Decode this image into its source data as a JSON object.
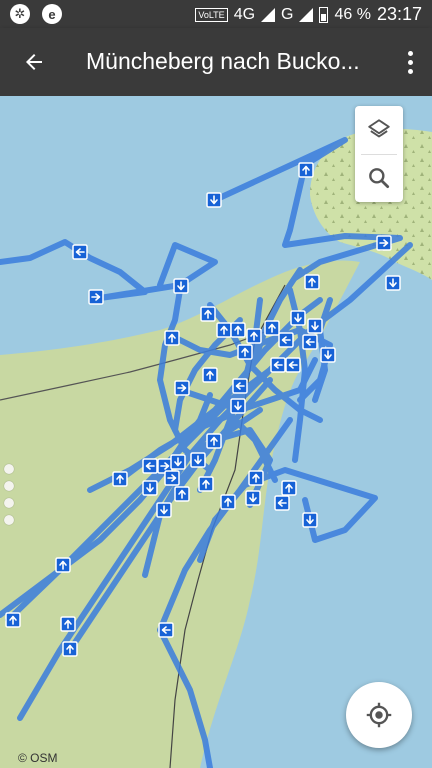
{
  "status_bar": {
    "carrier_badge": "e",
    "volte": "VoLTE",
    "network": "4G",
    "network2": "G",
    "battery": "46 %",
    "time": "23:17"
  },
  "toolbar": {
    "title": "Müncheberg nach Bucko..."
  },
  "map": {
    "attribution": "© OSM",
    "colors": {
      "water": "#9ecae1",
      "land": "#c8d8a2",
      "forest": "#cfe1a8",
      "track": "#3b7ddd",
      "marker": "#1762d6"
    }
  },
  "controls": {
    "layers_icon": "layers-icon",
    "search_icon": "search-icon",
    "locate_icon": "my-location-icon"
  }
}
